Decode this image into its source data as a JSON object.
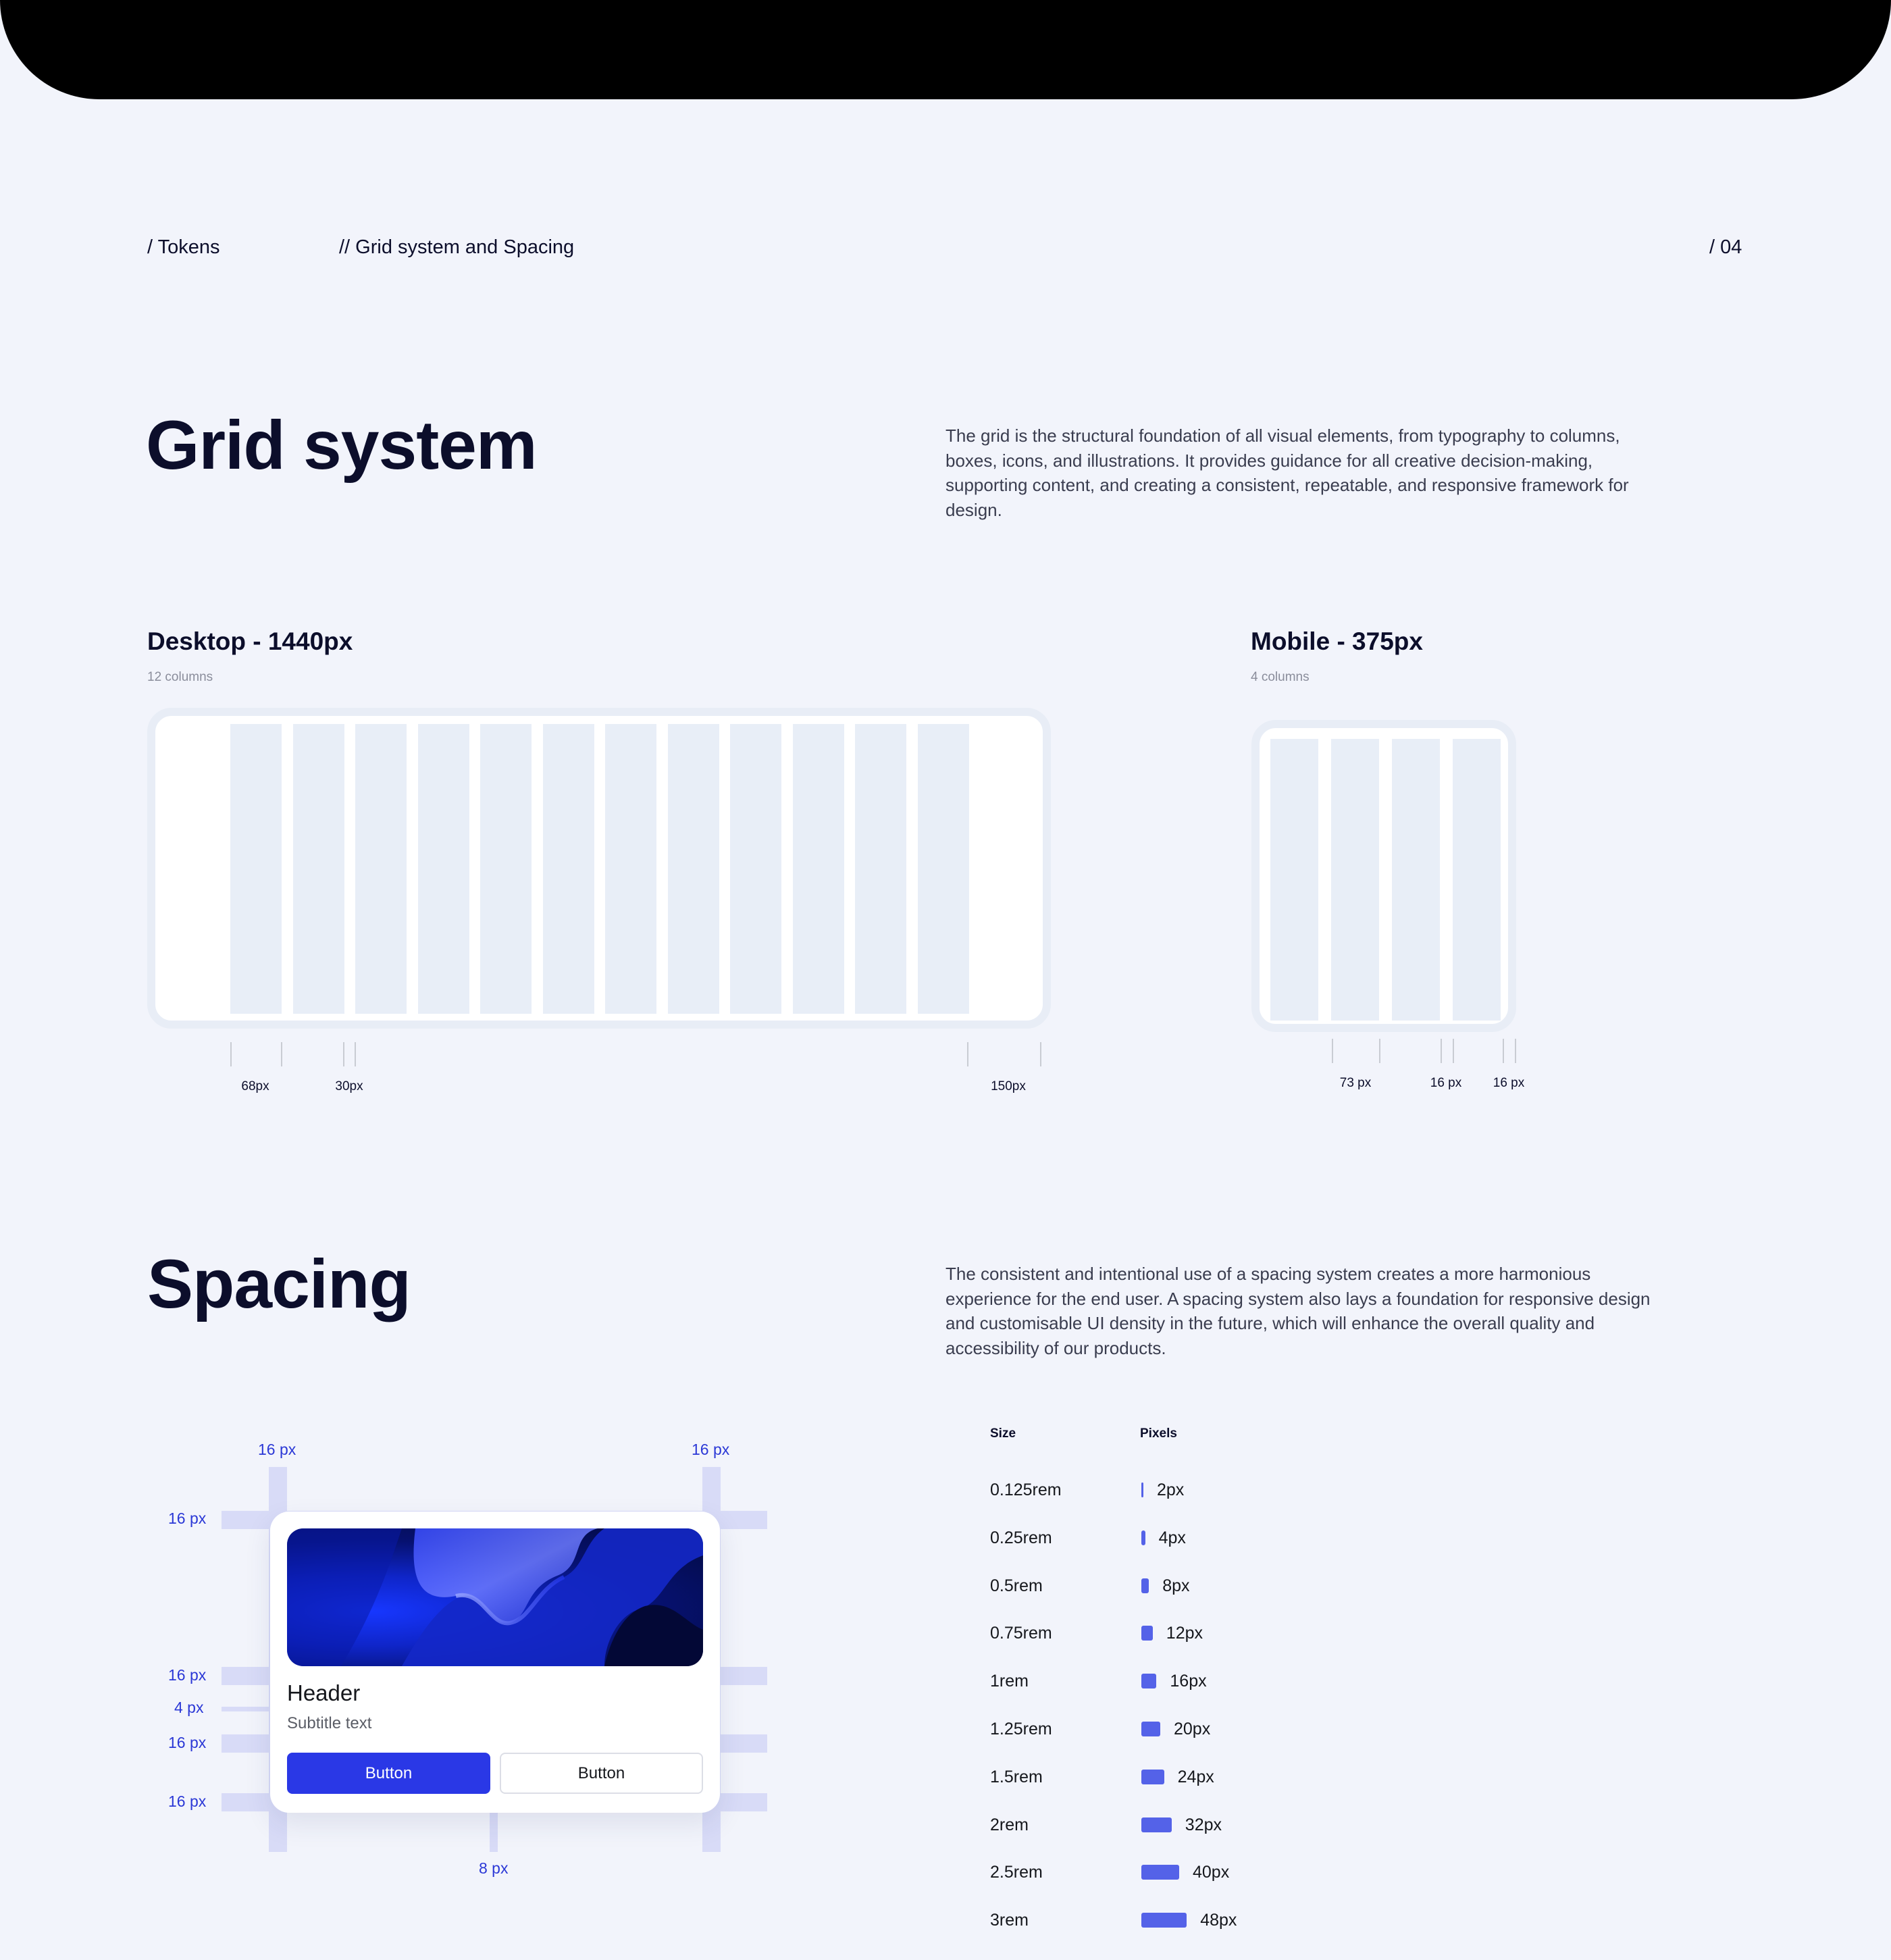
{
  "breadcrumb": {
    "section": "/ Tokens",
    "subsection": "// Grid system and Spacing",
    "page_number": "/ 04"
  },
  "grid": {
    "title": "Grid system",
    "description": "The grid is the structural foundation of all visual elements, from typography to columns, boxes, icons, and illustrations. It provides guidance for all creative decision-making, supporting content, and creating a consistent, repeatable, and responsive framework for design.",
    "desktop": {
      "title": "Desktop - 1440px",
      "columns_label": "12 columns",
      "columns": 12,
      "measures": [
        "68px",
        "30px",
        "150px"
      ]
    },
    "mobile": {
      "title": "Mobile - 375px",
      "columns_label": "4 columns",
      "columns": 4,
      "measures": [
        "73 px",
        "16 px",
        "16 px"
      ]
    }
  },
  "spacing": {
    "title": "Spacing",
    "description": "The consistent and intentional use of a spacing system creates a more harmonious experience for the end user. A spacing system also lays a foundation for responsive design and customisable UI density in the future, which will enhance the overall quality and accessibility of our products.",
    "illustration": {
      "labels": {
        "top_left": "16 px",
        "top_right": "16 px",
        "left_top": "16 px",
        "left_image": "16 px",
        "left_header": "4 px",
        "left_subtitle": "16 px",
        "left_bottom": "16 px",
        "bottom_gap": "8 px"
      },
      "card": {
        "header": "Header",
        "subtitle": "Subtitle text",
        "primary_button": "Button",
        "secondary_button": "Button"
      }
    },
    "table": {
      "headers": {
        "size": "Size",
        "pixels": "Pixels"
      },
      "accent_color": "#5462e8",
      "rows": [
        {
          "size": "0.125rem",
          "pixels": "2px",
          "value": 2
        },
        {
          "size": "0.25rem",
          "pixels": "4px",
          "value": 4
        },
        {
          "size": "0.5rem",
          "pixels": "8px",
          "value": 8
        },
        {
          "size": "0.75rem",
          "pixels": "12px",
          "value": 12
        },
        {
          "size": "1rem",
          "pixels": "16px",
          "value": 16
        },
        {
          "size": "1.25rem",
          "pixels": "20px",
          "value": 20
        },
        {
          "size": "1.5rem",
          "pixels": "24px",
          "value": 24
        },
        {
          "size": "2rem",
          "pixels": "32px",
          "value": 32
        },
        {
          "size": "2.5rem",
          "pixels": "40px",
          "value": 40
        },
        {
          "size": "3rem",
          "pixels": "48px",
          "value": 48
        }
      ]
    }
  }
}
